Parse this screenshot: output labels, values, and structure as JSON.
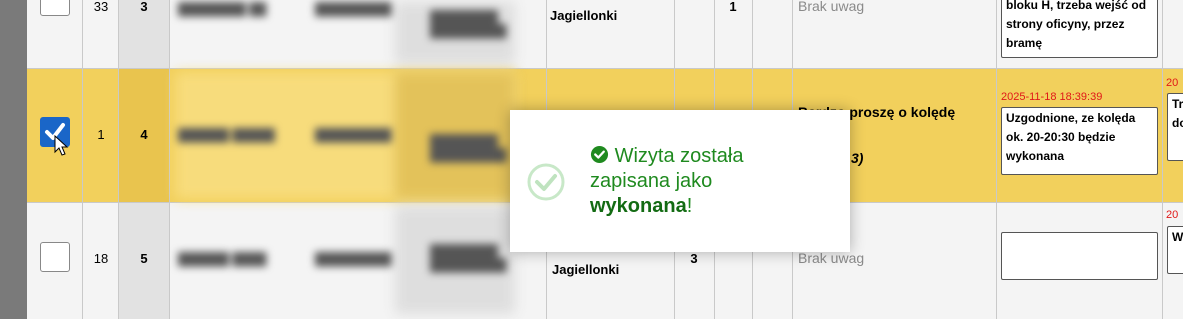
{
  "rows": [
    {
      "index": "33",
      "order": "3",
      "checked": false,
      "street": "Jagiellonki",
      "count": "1",
      "note": "Brak uwag",
      "comment": "bloku H, trzeba wejść od strony oficyny, przez bramę"
    },
    {
      "index": "1",
      "order": "4",
      "checked": true,
      "note": "Bardzo proszę o kolędę",
      "note_suffix": "3)",
      "timestamp": "2025-11-18 18:39:39",
      "comment": "Uzgodnione, ze kolęda ok. 20-20:30 będzie wykonana",
      "next_timestamp": "20",
      "next_comment": "Tr p do"
    },
    {
      "index": "18",
      "order": "5",
      "checked": false,
      "street": "Jagiellonki",
      "count": "3",
      "note": "Brak uwag",
      "comment": "",
      "next_timestamp": "20",
      "next_comment": "W ca"
    }
  ],
  "toast": {
    "line1": "Wizyta została",
    "line2": "zapisana jako",
    "strong": "wykonana",
    "suffix": "!"
  },
  "colors": {
    "highlight": "#f2d05c",
    "success": "#1f8a1f",
    "timestamp": "#e01818",
    "checkbox": "#1a66c8"
  },
  "icons": [
    "check-circle-icon",
    "checkmark-icon",
    "mouse-cursor-icon"
  ]
}
